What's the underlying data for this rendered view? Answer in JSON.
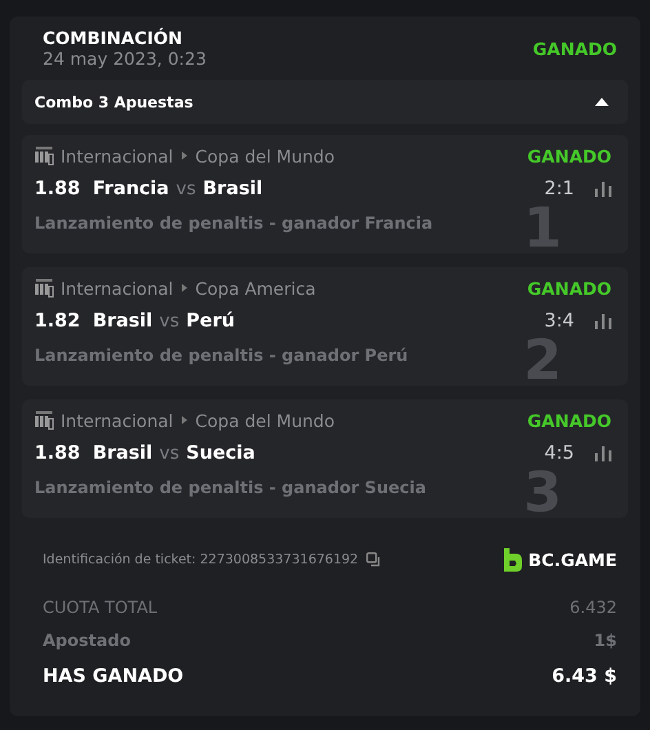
{
  "header": {
    "title": "COMBINACIÓN",
    "date": "24 may 2023, 0:23",
    "status": "GANADO"
  },
  "combo": {
    "label": "Combo 3 Apuestas",
    "expanded": true
  },
  "bets": [
    {
      "number": "1",
      "category": "Internacional",
      "league": "Copa del Mundo",
      "status": "GANADO",
      "odds": "1.88",
      "home": "Francia",
      "vs": "vs",
      "away": "Brasil",
      "score": "2:1",
      "market": "Lanzamiento de penaltis - ganador Francia"
    },
    {
      "number": "2",
      "category": "Internacional",
      "league": "Copa America",
      "status": "GANADO",
      "odds": "1.82",
      "home": "Brasil",
      "vs": "vs",
      "away": "Perú",
      "score": "3:4",
      "market": "Lanzamiento de penaltis - ganador Perú"
    },
    {
      "number": "3",
      "category": "Internacional",
      "league": "Copa del Mundo",
      "status": "GANADO",
      "odds": "1.88",
      "home": "Brasil",
      "vs": "vs",
      "away": "Suecia",
      "score": "4:5",
      "market": "Lanzamiento de penaltis - ganador Suecia"
    }
  ],
  "ticket": {
    "label": "Identificación de ticket: 2273008533731676192",
    "brand": "BC.GAME"
  },
  "totals": [
    {
      "kind": "muted",
      "label": "CUOTA TOTAL",
      "value": "6.432"
    },
    {
      "kind": "bold-muted",
      "label": "Apostado",
      "value": "1$"
    },
    {
      "kind": "strong",
      "label": "HAS GANADO",
      "value": "6.43 $"
    }
  ]
}
